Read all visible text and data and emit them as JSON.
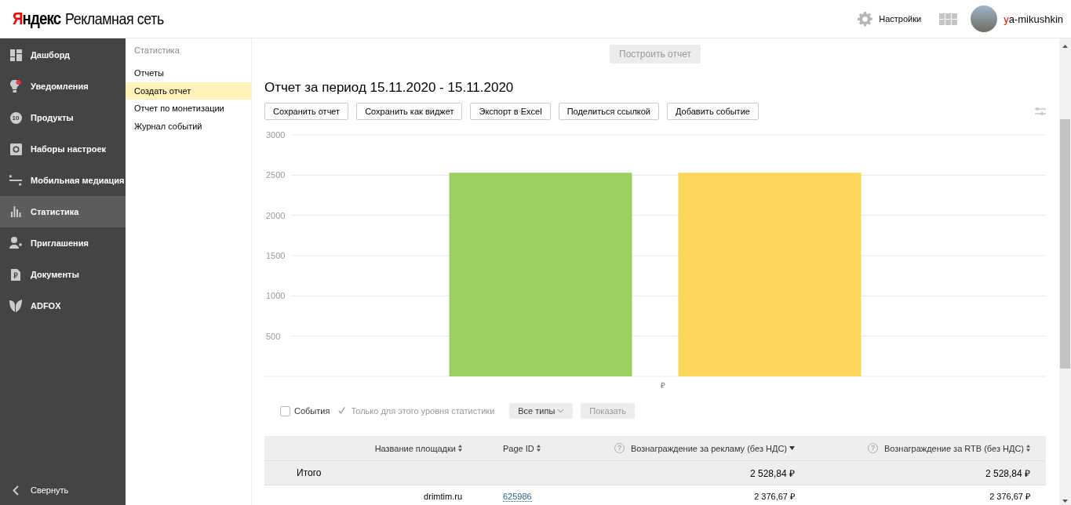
{
  "header": {
    "brand": "Яндекс",
    "product": "Рекламная сеть",
    "settings": "Настройки",
    "login": "ya-mikushkin"
  },
  "sidebar": {
    "items": [
      {
        "label": "Дашборд",
        "selected": false
      },
      {
        "label": "Уведомления",
        "selected": false,
        "alert": true
      },
      {
        "label": "Продукты",
        "selected": false,
        "badge": "10"
      },
      {
        "label": "Наборы настроек",
        "selected": false
      },
      {
        "label": "Мобильная медиация",
        "selected": false
      },
      {
        "label": "Статистика",
        "selected": true
      },
      {
        "label": "Приглашения",
        "selected": false
      },
      {
        "label": "Документы",
        "selected": false
      },
      {
        "label": "ADFOX",
        "selected": false
      }
    ],
    "collapse": "Свернуть"
  },
  "subnav": {
    "title": "Статистика",
    "items": [
      {
        "label": "Отчеты",
        "selected": false
      },
      {
        "label": "Создать отчет",
        "selected": true
      },
      {
        "label": "Отчет по монетизации",
        "selected": false
      },
      {
        "label": "Журнал событий",
        "selected": false
      }
    ]
  },
  "build_button": {
    "label": "Построить отчет",
    "disabled": true
  },
  "report": {
    "title": "Отчет за период 15.11.2020 - 15.11.2020",
    "actions": [
      "Сохранить отчет",
      "Сохранить как виджет",
      "Экспорт в Excel",
      "Поделиться ссылкой",
      "Добавить событие"
    ],
    "chart_data": {
      "type": "bar",
      "categories": [
        "₽"
      ],
      "series": [
        {
          "color": "#9ccf5f",
          "values": [
            2530
          ]
        },
        {
          "color": "#fdd75a",
          "values": [
            2530
          ]
        }
      ],
      "ylim": [
        0,
        3000
      ],
      "yticks": [
        500,
        1000,
        1500,
        2000,
        2500,
        3000
      ],
      "grid": true
    }
  },
  "filters": {
    "events": {
      "label": "События",
      "checked": false
    },
    "level_only": {
      "label": "Только для этого уровня статистики",
      "checked": true,
      "disabled": true
    },
    "type_select": "Все типы",
    "show_button": {
      "label": "Показать",
      "disabled": true
    }
  },
  "table": {
    "columns": [
      {
        "label": "Название площадки",
        "sorted_desc": false
      },
      {
        "label": "Page ID",
        "sorted_desc": false
      },
      {
        "help": "?",
        "label": "Вознаграждение за рекламу (без НДС)",
        "sorted_desc": true
      },
      {
        "help": "?",
        "label": "Вознаграждение за RTB (без НДС)",
        "sorted_desc": false
      }
    ],
    "total": {
      "label": "Итого",
      "values": [
        "2 528,84 ₽",
        "2 528,84 ₽"
      ]
    },
    "rows": [
      {
        "name": "drimtim.ru",
        "page_id": "625986",
        "values": [
          "2 376,67 ₽",
          "2 376,67 ₽"
        ]
      }
    ]
  }
}
